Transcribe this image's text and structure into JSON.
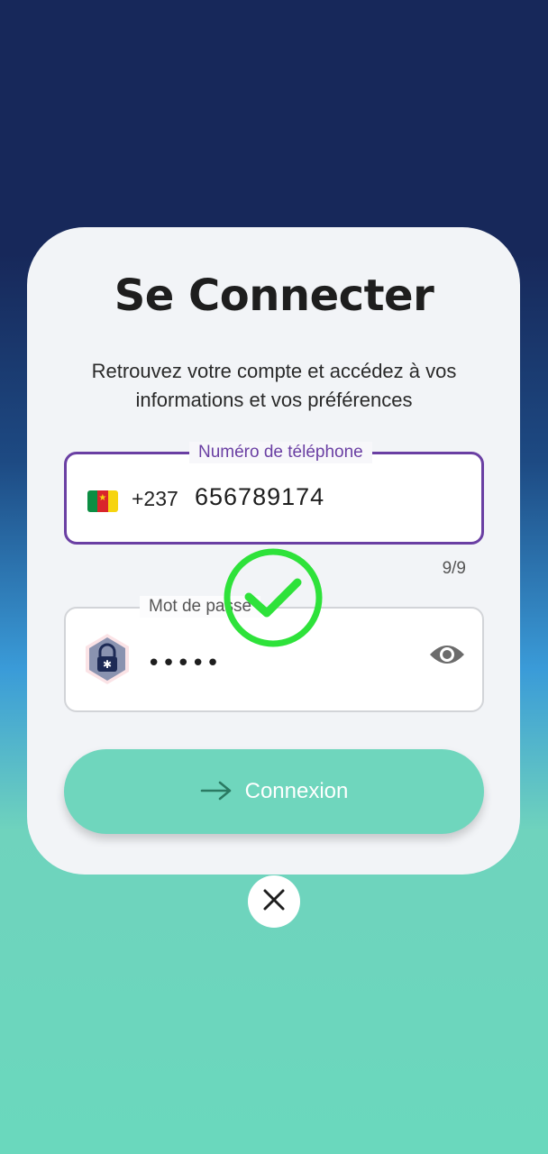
{
  "login": {
    "title": "Se Connecter",
    "subtitle_line1": "Retrouvez votre compte et accédez à vos",
    "subtitle_line2": "informations et vos préférences",
    "phone": {
      "label": "Numéro de téléphone",
      "country_flag": "cameroon-flag-icon",
      "dial_code": "+237",
      "value": "656789174",
      "counter": "9/9"
    },
    "password": {
      "label": "Mot de passe",
      "masked_value": "•••••",
      "lock_icon": "lock-icon",
      "toggle_icon": "eye-icon"
    },
    "submit": {
      "label": "Connexion",
      "icon": "arrow-right-icon"
    },
    "close_icon": "close-icon",
    "validation_icon": "check-circle-icon"
  },
  "colors": {
    "accent_purple": "#6a3fa3",
    "button_teal": "#6fd6bd",
    "check_green": "#2ee23a",
    "bg_top": "#17285a"
  }
}
